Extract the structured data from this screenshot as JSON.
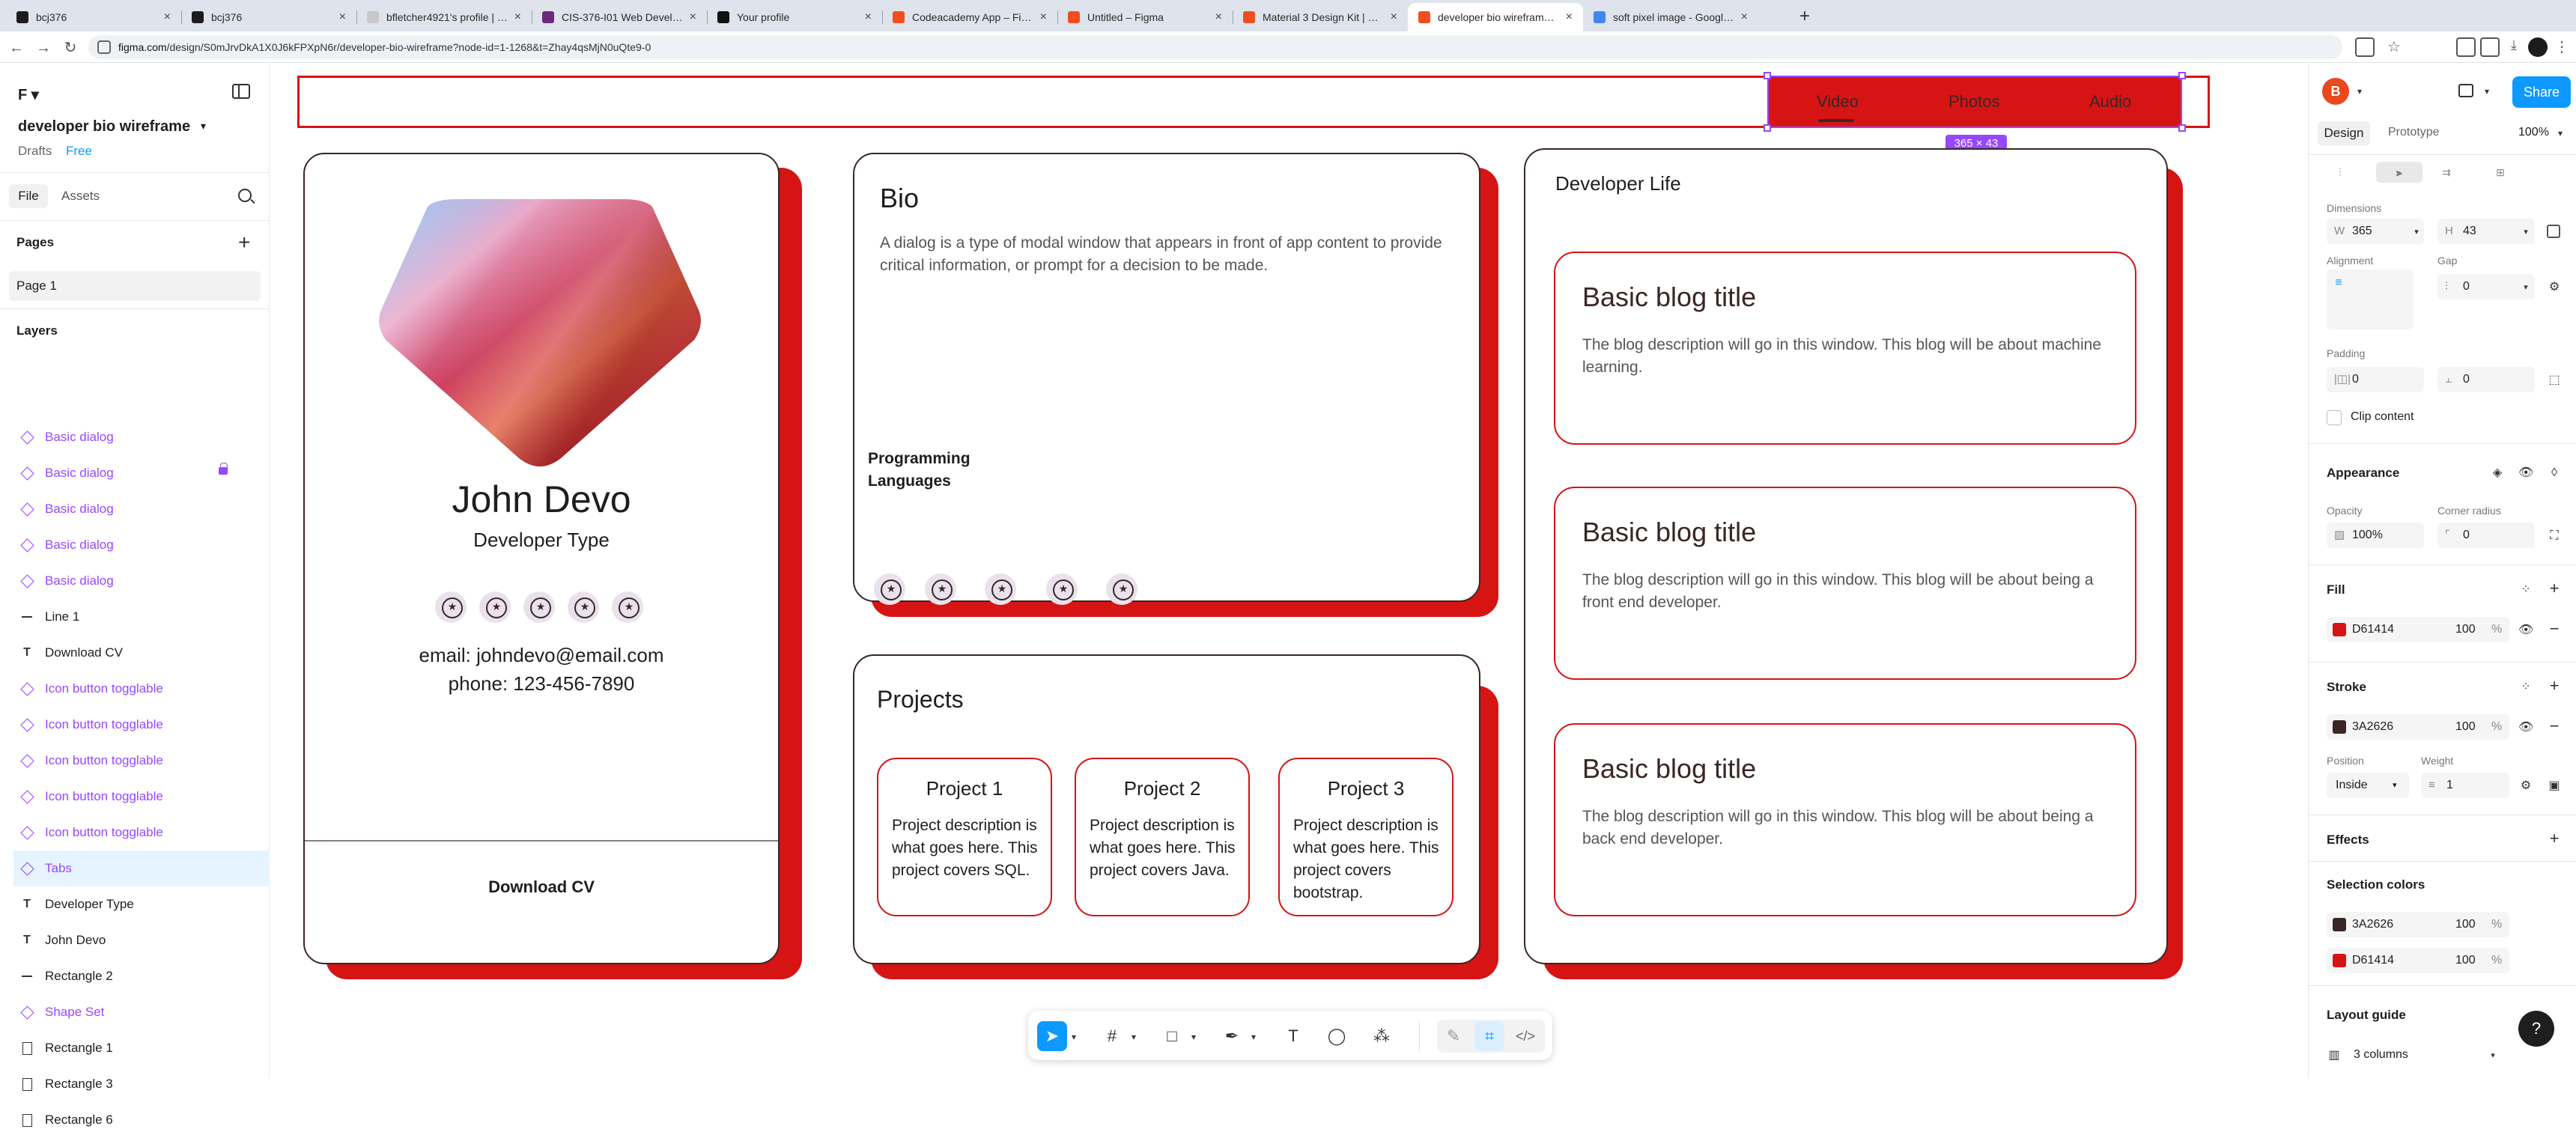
{
  "browser": {
    "tabs": [
      {
        "title": "bcj376",
        "color": "#1c1c1c"
      },
      {
        "title": "bcj376",
        "color": "#1c1c1c"
      },
      {
        "title": "bfletcher4921's profile | Codec...",
        "color": "#c8c8c8"
      },
      {
        "title": "CIS-376-I01 Web Development",
        "color": "#6b2b7a"
      },
      {
        "title": "Your profile",
        "color": "#111111"
      },
      {
        "title": "Codeacademy App – Figma",
        "color": "#f24e1e"
      },
      {
        "title": "Untitled – Figma",
        "color": "#f24e1e"
      },
      {
        "title": "Material 3 Design Kit | Figma",
        "color": "#f24e1e"
      },
      {
        "title": "developer bio wireframe – Figm...",
        "color": "#f24e1e"
      },
      {
        "title": "soft pixel image - Google Sear...",
        "color": "#4285f4"
      }
    ],
    "active_tab": 8,
    "new_tab": "+",
    "url_host": "figma.com",
    "url_path": "/design/S0mJrvDkA1X0J6kFPXpN6r/developer-bio-wireframe?node-id=1-1268&t=Zhay4qsMjN0uQte9-0",
    "back": "←",
    "forward": "→",
    "reload": "↻"
  },
  "left_panel": {
    "figma_menu": "F ▾",
    "file_name": "developer bio wireframe",
    "file_chevron": "▾",
    "drafts": "Drafts",
    "plan": "Free",
    "tab_file": "File",
    "tab_assets": "Assets",
    "pages_heading": "Pages",
    "add_page": "+",
    "page_1": "Page 1",
    "layers_heading": "Layers",
    "layers": [
      {
        "name": "Basic dialog",
        "type": "diamond",
        "component": true
      },
      {
        "name": "Basic dialog",
        "type": "diamond",
        "component": true,
        "locked": true
      },
      {
        "name": "Basic dialog",
        "type": "diamond",
        "component": true
      },
      {
        "name": "Basic dialog",
        "type": "diamond",
        "component": true
      },
      {
        "name": "Basic dialog",
        "type": "diamond",
        "component": true
      },
      {
        "name": "Line 1",
        "type": "line",
        "component": false
      },
      {
        "name": "Download CV",
        "type": "text",
        "component": false
      },
      {
        "name": "Icon button togglable",
        "type": "diamond",
        "component": true
      },
      {
        "name": "Icon button togglable",
        "type": "diamond",
        "component": true
      },
      {
        "name": "Icon button togglable",
        "type": "diamond",
        "component": true
      },
      {
        "name": "Icon button togglable",
        "type": "diamond",
        "component": true
      },
      {
        "name": "Icon button togglable",
        "type": "diamond",
        "component": true
      },
      {
        "name": "Tabs",
        "type": "diamond",
        "component": true,
        "selected": true
      },
      {
        "name": "Developer Type",
        "type": "text",
        "component": false
      },
      {
        "name": "John Devo",
        "type": "text",
        "component": false
      },
      {
        "name": "Rectangle 2",
        "type": "line",
        "component": false
      },
      {
        "name": "Shape Set",
        "type": "diamond",
        "component": true
      },
      {
        "name": "Rectangle 1",
        "type": "rect",
        "component": false
      },
      {
        "name": "Rectangle 3",
        "type": "rect",
        "component": false
      },
      {
        "name": "Rectangle 6",
        "type": "rect",
        "component": false
      }
    ]
  },
  "canvas": {
    "tabs": {
      "video": "Video",
      "photos": "Photos",
      "audio": "Audio"
    },
    "selection_size": "365 × 43",
    "profile": {
      "name": "John Devo",
      "developer_type": "Developer Type",
      "email": "email: johndevo@email.com",
      "phone": "phone: 123-456-7890",
      "download_cv": "Download CV"
    },
    "bio": {
      "title": "Bio",
      "text": "A dialog is a type of modal window that appears in front of app content to provide critical information, or prompt for a decision to be made.",
      "programming_label": "Programming Languages"
    },
    "projects": {
      "title": "Projects",
      "items": [
        {
          "title": "Project 1",
          "desc": "Project description is what goes here. This project covers SQL."
        },
        {
          "title": "Project 2",
          "desc": "Project description is what goes here. This project covers Java."
        },
        {
          "title": "Project 3",
          "desc": "Project description is what goes here. This project covers bootstrap."
        }
      ]
    },
    "developer_life": {
      "title": "Developer Life",
      "blogs": [
        {
          "title": "Basic blog title",
          "desc": "The blog description will go in this window. This blog will be about machine learning."
        },
        {
          "title": "Basic blog title",
          "desc": "The blog description will go in this window. This blog will be about being a front end developer."
        },
        {
          "title": "Basic blog title",
          "desc": "The blog description will go in this window. This blog will be about being a back end developer."
        }
      ]
    },
    "accent": "#D61414",
    "stroke": "#3A2626"
  },
  "right_panel": {
    "avatar": "B",
    "share": "Share",
    "tab_design": "Design",
    "tab_prototype": "Prototype",
    "zoom": "100%",
    "dimensions_label": "Dimensions",
    "width_prefix": "W",
    "width": "365",
    "height_prefix": "H",
    "height": "43",
    "alignment_label": "Alignment",
    "gap_label": "Gap",
    "gap": "0",
    "padding_label": "Padding",
    "padding_h": "0",
    "padding_v": "0",
    "clip_content": "Clip content",
    "appearance": "Appearance",
    "opacity_label": "Opacity",
    "opacity": "100%",
    "radius_label": "Corner radius",
    "radius": "0",
    "fill": "Fill",
    "fill_hex": "D61414",
    "fill_opacity": "100",
    "stroke": "Stroke",
    "stroke_hex": "3A2626",
    "stroke_opacity": "100",
    "position_label": "Position",
    "position": "Inside",
    "weight_label": "Weight",
    "weight": "1",
    "effects": "Effects",
    "selection_colors": "Selection colors",
    "sel_colors": [
      {
        "hex": "3A2626",
        "opacity": "100"
      },
      {
        "hex": "D61414",
        "opacity": "100"
      }
    ],
    "layout_guide": "Layout guide",
    "columns": "3 columns",
    "percent": "%",
    "help": "?"
  }
}
